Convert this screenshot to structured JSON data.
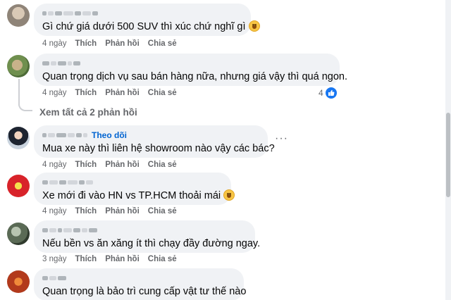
{
  "comments": [
    {
      "text": "Gì chứ giá dưới 500 SUV thì xúc chứ nghĩ gì",
      "emoji": "smiling-face-emoji",
      "time": "4 ngày",
      "like": "Thích",
      "reply": "Phản hồi",
      "share": "Chia sẻ"
    },
    {
      "text": "Quan trọng dịch vụ sau bán hàng nữa, nhưng giá vậy thì quá ngon.",
      "time": "4 ngày",
      "like": "Thích",
      "reply": "Phản hồi",
      "share": "Chia sẻ",
      "reaction_count": "4"
    },
    {
      "follow": "Theo dõi",
      "text": "Mua xe này thì liên hệ showroom nào vậy các bác?",
      "time": "4 ngày",
      "like": "Thích",
      "reply": "Phản hồi",
      "share": "Chia sẻ",
      "more": "···"
    },
    {
      "text": "Xe mới đi vào HN vs TP.HCM thoải mái",
      "emoji": "grinning-face-emoji",
      "time": "4 ngày",
      "like": "Thích",
      "reply": "Phản hồi",
      "share": "Chia sẻ"
    },
    {
      "text": "Nếu bền vs ăn xăng ít thì chạy đầy đường ngay.",
      "time": "3 ngày",
      "like": "Thích",
      "reply": "Phản hồi",
      "share": "Chia sẻ"
    },
    {
      "text": "Quan trọng là bảo trì cung cấp vật tư thế nào"
    }
  ],
  "view_replies": "Xem tất cả 2 phản hồi",
  "colors": {
    "bubble": "#f0f2f5",
    "link": "#0064d1",
    "meta": "#65676b",
    "like": "#1877f2"
  }
}
